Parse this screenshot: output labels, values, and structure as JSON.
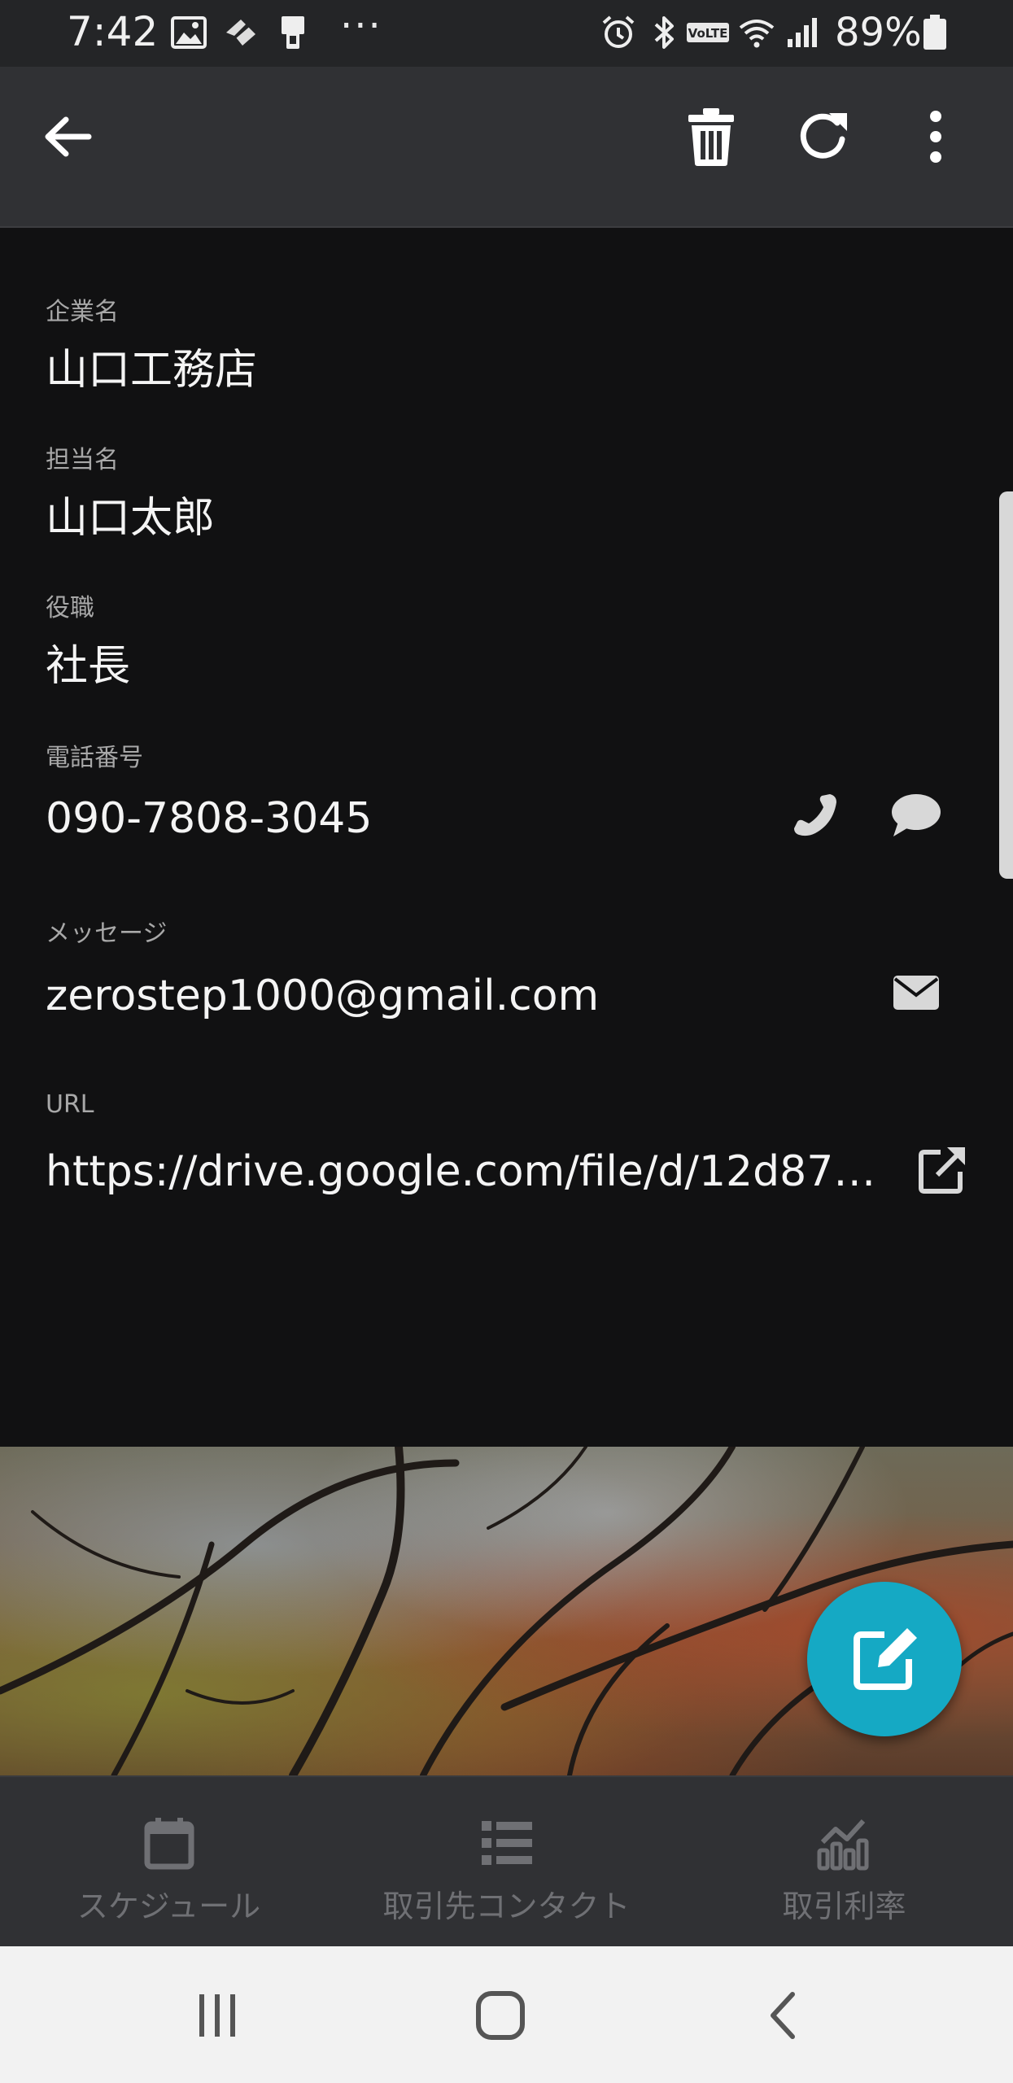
{
  "status_bar": {
    "time": "7:42",
    "more_indicator": "···",
    "battery_percent": "89%",
    "icons": [
      "image-icon",
      "pinwheel-icon",
      "device-icon",
      "alarm-icon",
      "bluetooth-icon",
      "volte-icon",
      "wifi-icon",
      "signal-icon",
      "battery-icon"
    ]
  },
  "toolbar": {
    "icons": [
      "back-arrow-icon",
      "trash-icon",
      "refresh-icon",
      "more-vert-icon"
    ]
  },
  "fields": {
    "company": {
      "label": "企業名",
      "value": "山口工務店"
    },
    "contact": {
      "label": "担当名",
      "value": "山口太郎"
    },
    "title": {
      "label": "役職",
      "value": "社長"
    },
    "phone": {
      "label": "電話番号",
      "value": "090-7808-3045"
    },
    "message": {
      "label": "メッセージ",
      "value": "zerostep1000@gmail.com"
    },
    "url": {
      "label": "URL",
      "value": "https://drive.google.com/file/d/12d876..."
    }
  },
  "fab": {
    "icon": "edit-icon",
    "color": "#15a9c4"
  },
  "bottom_nav": {
    "items": [
      {
        "label": "スケジュール",
        "icon": "calendar-icon"
      },
      {
        "label": "取引先コンタクト",
        "icon": "list-icon"
      },
      {
        "label": "取引利率",
        "icon": "chart-icon"
      }
    ]
  },
  "system_nav": {
    "icons": [
      "recents-icon",
      "home-icon",
      "back-icon"
    ]
  },
  "colors": {
    "background": "#111112",
    "toolbar": "#303134",
    "accent": "#15a9c4",
    "nav_inactive": "#6f7074"
  }
}
